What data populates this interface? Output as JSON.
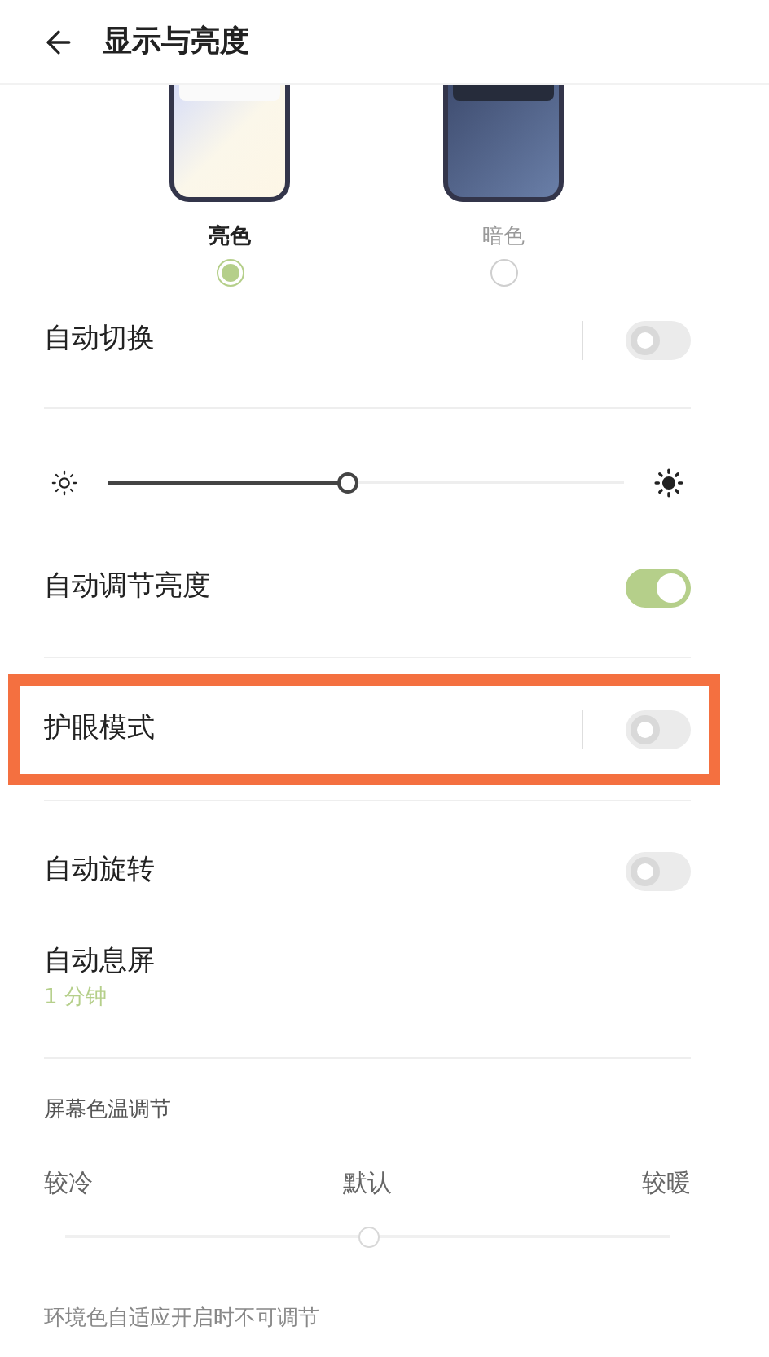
{
  "header": {
    "title": "显示与亮度"
  },
  "themes": [
    {
      "label": "亮色",
      "kind": "light",
      "selected": true
    },
    {
      "label": "暗色",
      "kind": "dark",
      "selected": false
    }
  ],
  "auto_switch": {
    "label": "自动切换",
    "on": false
  },
  "brightness": {
    "level": 0.465
  },
  "auto_brightness": {
    "label": "自动调节亮度",
    "on": true
  },
  "eye_care": {
    "label": "护眼模式",
    "on": false,
    "highlighted": true
  },
  "auto_rotate": {
    "label": "自动旋转",
    "on": false
  },
  "screen_timeout": {
    "label": "自动息屏",
    "value": "1 分钟"
  },
  "color_temperature": {
    "title": "屏幕色温调节",
    "labels": [
      "较冷",
      "默认",
      "较暖"
    ],
    "level": 0.5,
    "note": "环境色自适应开启时不可调节"
  }
}
